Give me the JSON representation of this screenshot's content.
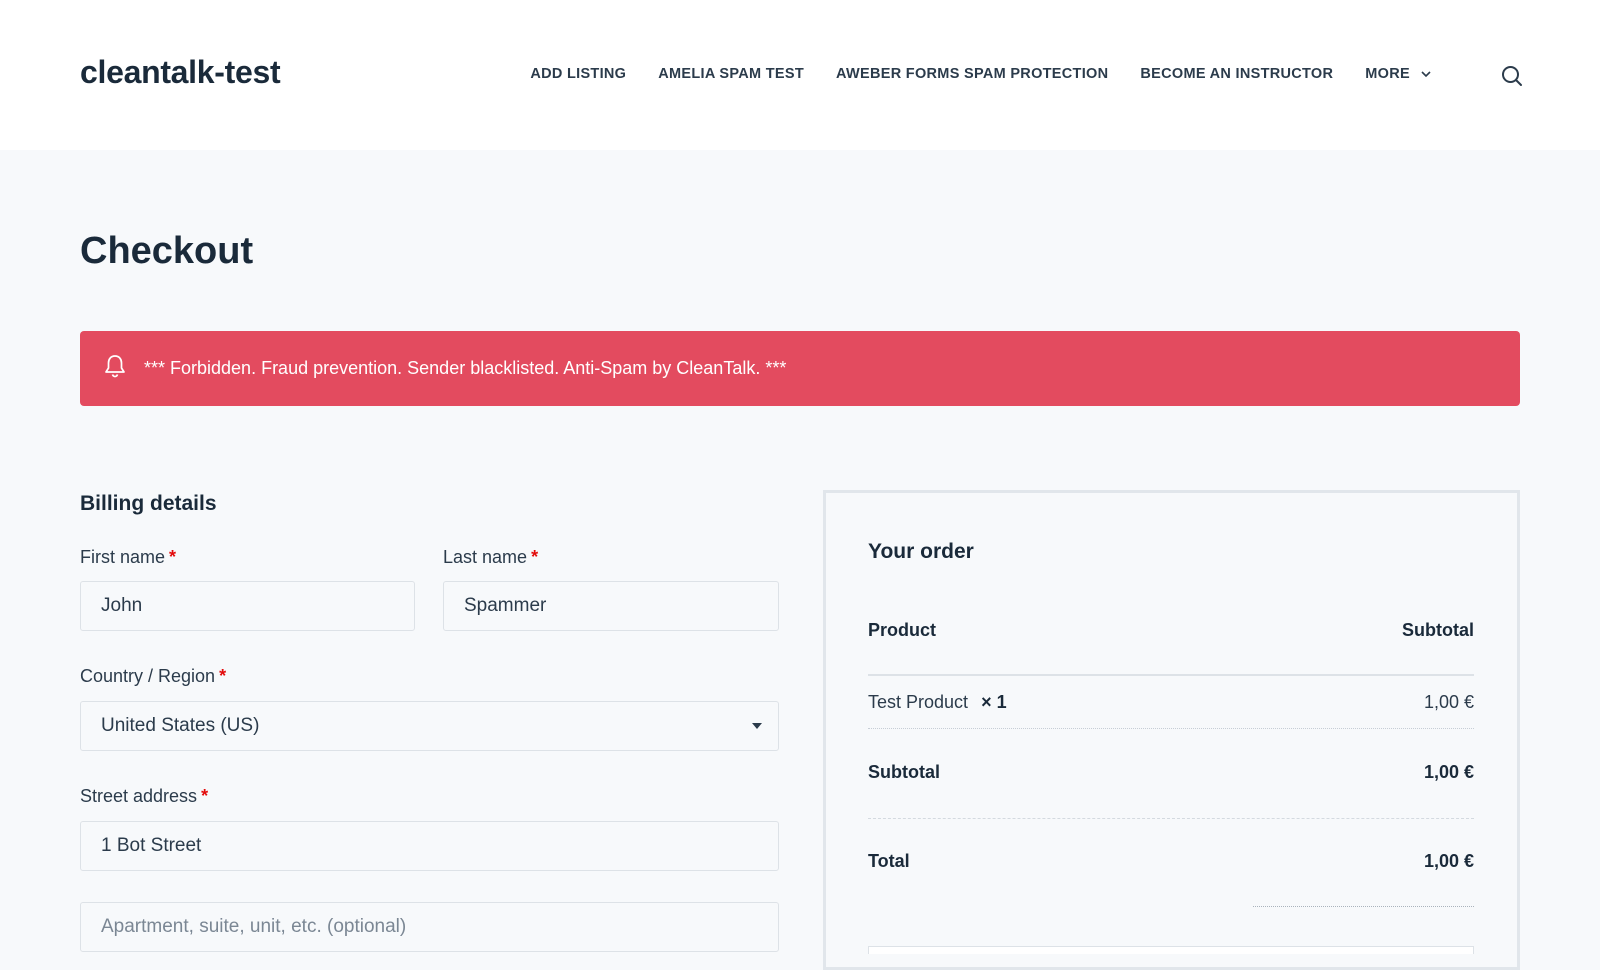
{
  "site": {
    "title": "cleantalk-test"
  },
  "nav": {
    "items": [
      {
        "label": "ADD LISTING"
      },
      {
        "label": "AMELIA SPAM TEST"
      },
      {
        "label": "AWEBER FORMS SPAM PROTECTION"
      },
      {
        "label": "BECOME AN INSTRUCTOR"
      },
      {
        "label": "MORE"
      }
    ],
    "search_icon": "search-icon"
  },
  "page": {
    "title": "Checkout"
  },
  "notice": {
    "icon": "bell-icon",
    "text": "*** Forbidden. Fraud prevention. Sender blacklisted. Anti-Spam by CleanTalk. ***",
    "color": "#e34b5f"
  },
  "billing": {
    "title": "Billing details",
    "required_mark": "*",
    "first_name": {
      "label": "First name",
      "value": "John"
    },
    "last_name": {
      "label": "Last name",
      "value": "Spammer"
    },
    "country": {
      "label": "Country / Region",
      "value": "United States (US)"
    },
    "street": {
      "label": "Street address",
      "value": "1 Bot Street",
      "line2_placeholder": "Apartment, suite, unit, etc. (optional)"
    }
  },
  "order": {
    "title": "Your order",
    "col_product": "Product",
    "col_subtotal": "Subtotal",
    "item": {
      "name": "Test Product",
      "qty": "× 1",
      "price": "1,00 €"
    },
    "subtotal_label": "Subtotal",
    "subtotal_value": "1,00 €",
    "total_label": "Total",
    "total_value": "1,00 €"
  }
}
